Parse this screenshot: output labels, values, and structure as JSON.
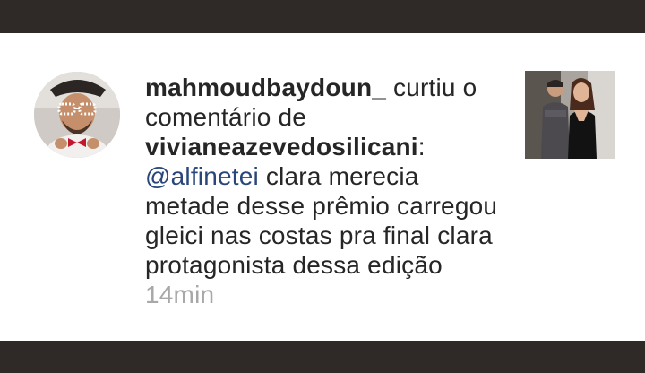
{
  "notification": {
    "actor_username": "mahmoudbaydoun_",
    "action_text": " curtiu o comentário de ",
    "comment_author": "vivianeazevedosilicani",
    "colon": ":",
    "mention": "@alfinetei",
    "comment_body": " clara merecia metade desse prêmio carregou gleici nas costas pra final clara protagonista dessa edição",
    "timestamp": "14min"
  },
  "colors": {
    "frame_bar": "#2f2a27",
    "background": "#ffffff",
    "text": "#262626",
    "mention": "#28467a",
    "timestamp": "#a8a8a8"
  },
  "icons": {
    "avatar": "profile-photo",
    "thumbnail": "post-photo"
  }
}
